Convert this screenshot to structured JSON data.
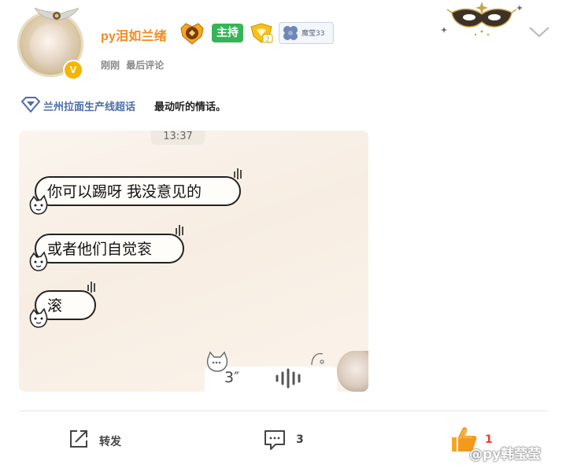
{
  "user": {
    "name": "py泪如兰绪",
    "host_badge": "主持",
    "clover_badge_text": "魔莹33",
    "verified_mark": "V",
    "time": "刚刚",
    "time_suffix": "最后评论"
  },
  "post": {
    "topic": "兰州拉面生产线超话",
    "text": "最动听的情话。"
  },
  "image": {
    "chat_time": "13:37",
    "messages": [
      "你可以踢呀 我没意见的",
      "或者他们自觉衮",
      "滚"
    ],
    "voice_duration": "3″"
  },
  "actions": {
    "repost_label": "转发",
    "comment_count": "3",
    "like_count": "1"
  },
  "watermark": "@py韩莹莹",
  "colors": {
    "username": "#f08c22",
    "host_badge": "#35b558",
    "topic_link": "#4d6ea8",
    "like": "#e8402c"
  },
  "icons": [
    "avatar-frame-icon",
    "medal-icon",
    "level-icon",
    "clover-icon",
    "mask-decoration-icon",
    "chevron-down-icon",
    "super-topic-diamond-icon",
    "repost-icon",
    "comment-icon",
    "like-thumb-icon",
    "voice-wave-icon",
    "cat-sticker-icon"
  ]
}
